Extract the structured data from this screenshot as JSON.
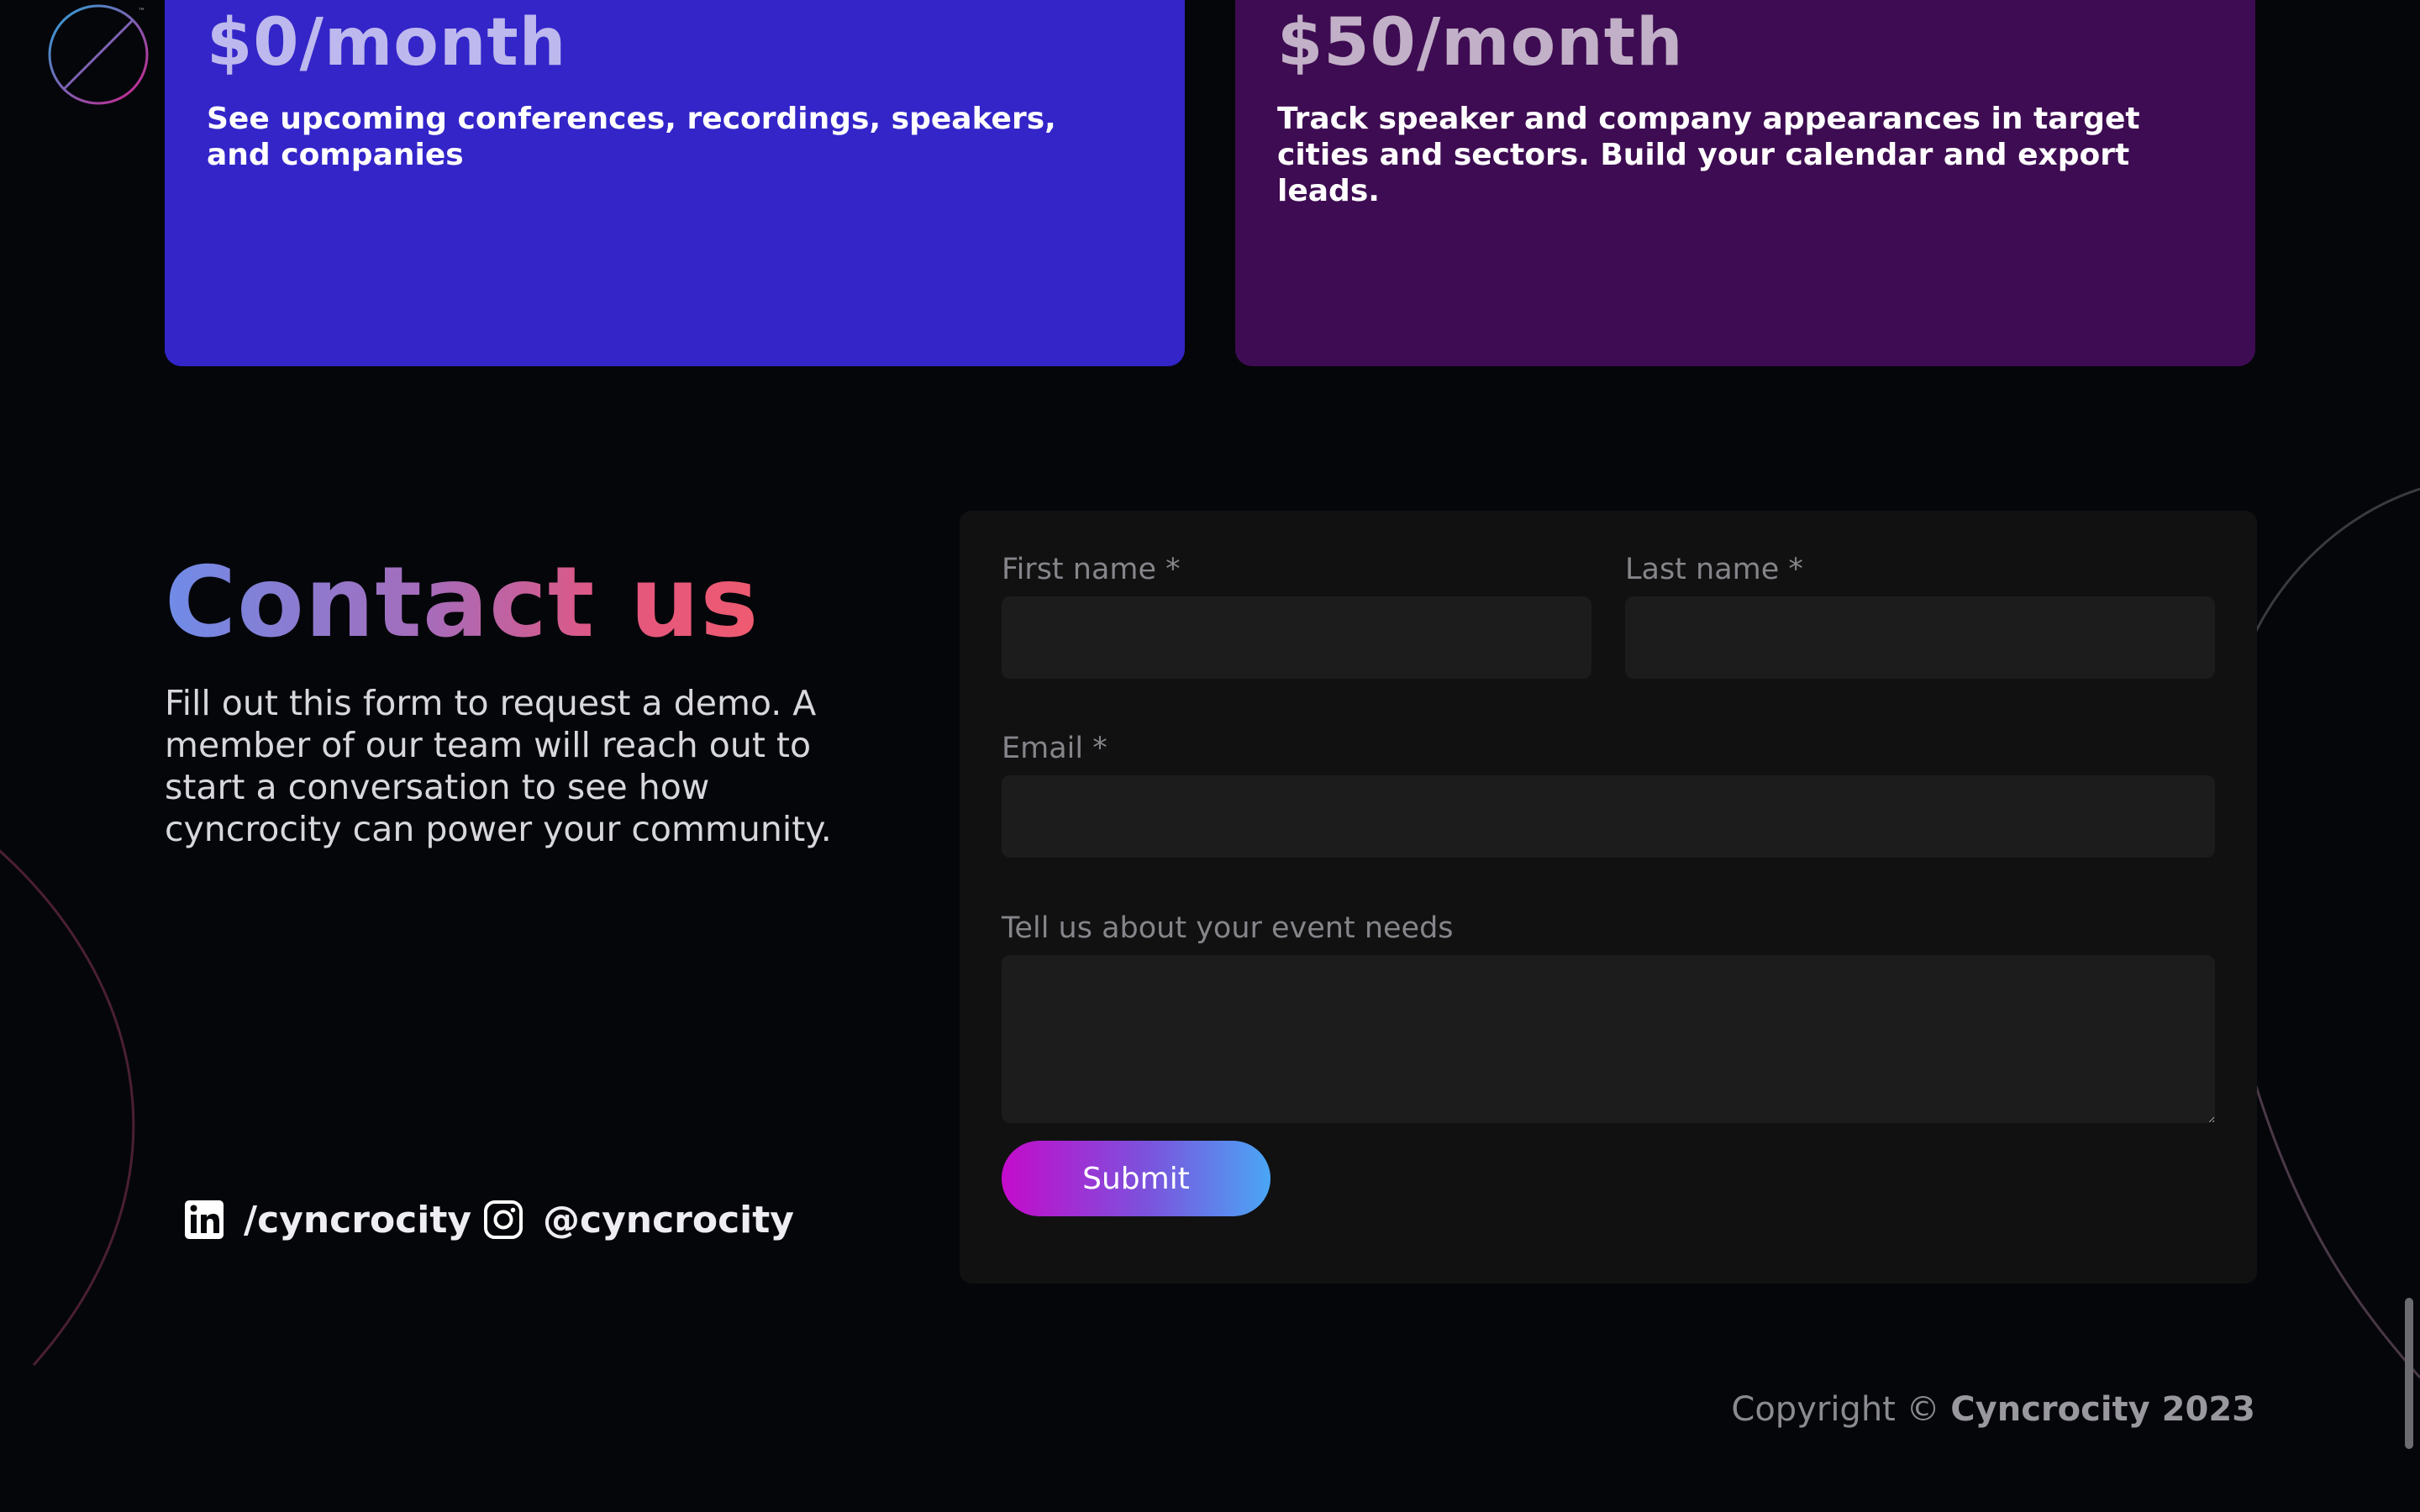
{
  "brand": {
    "logo_icon": "cyncrocity-logo-icon"
  },
  "pricing": {
    "free": {
      "price": "$0/month",
      "description": "See upcoming conferences, recordings, speakers, and companies",
      "color": "#3325c8"
    },
    "pro": {
      "price": "$50/month",
      "description": "Track speaker and company appearances in target cities and sectors. Build your calendar and export leads.",
      "color": "#3e0c52"
    }
  },
  "contact": {
    "title": "Contact us",
    "description": "Fill out this form to request a demo. A member of our team will reach out to start a conversation to see how cyncrocity can power your community."
  },
  "social": {
    "linkedin": {
      "label": "/cyncrocity",
      "icon": "linkedin-icon"
    },
    "instagram": {
      "label": "@cyncrocity",
      "icon": "instagram-icon"
    }
  },
  "form": {
    "first_name_label": "First name *",
    "first_name_value": "",
    "last_name_label": "Last name *",
    "last_name_value": "",
    "email_label": "Email *",
    "email_value": "",
    "needs_label": "Tell us about your event needs",
    "needs_value": "",
    "submit_label": "Submit"
  },
  "footer": {
    "copyright_prefix": "Copyright ©",
    "copyright_brand": "Cyncrocity 2023"
  },
  "colors": {
    "background": "#05060a",
    "form_panel": "#111112",
    "input": "#1c1c1d",
    "accent_gradient_start": "#c40bcb",
    "accent_gradient_end": "#4aa6f5"
  }
}
